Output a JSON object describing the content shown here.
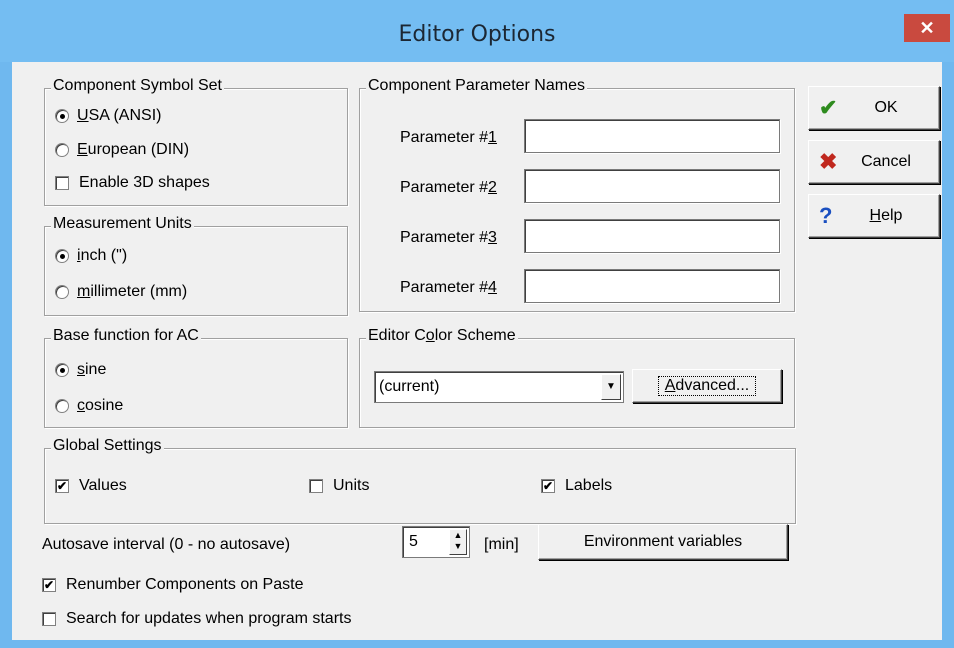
{
  "window": {
    "title": "Editor Options",
    "close_glyph": "✕"
  },
  "symbol_set": {
    "title": "Component Symbol Set",
    "options": [
      {
        "accel": "U",
        "rest": "SA (ANSI)",
        "selected": true
      },
      {
        "accel": "E",
        "rest": "uropean (DIN)",
        "selected": false
      }
    ],
    "enable_3d": {
      "label": "Enable 3D shapes",
      "checked": false
    }
  },
  "param_names": {
    "title": "Component Parameter Names",
    "params": [
      {
        "prefix": "Parameter #",
        "accel": "1",
        "value": ""
      },
      {
        "prefix": "Parameter #",
        "accel": "2",
        "value": ""
      },
      {
        "prefix": "Parameter #",
        "accel": "3",
        "value": ""
      },
      {
        "prefix": "Parameter #",
        "accel": "4",
        "value": ""
      }
    ]
  },
  "units": {
    "title": "Measurement Units",
    "options": [
      {
        "accel": "i",
        "rest": "nch (\")",
        "selected": true
      },
      {
        "accel": "m",
        "rest": "illimeter (mm)",
        "selected": false
      }
    ]
  },
  "ac_function": {
    "title": "Base function for AC",
    "options": [
      {
        "accel": "s",
        "rest": "ine",
        "selected": true
      },
      {
        "accel": "c",
        "rest": "osine",
        "selected": false
      }
    ]
  },
  "color_scheme": {
    "title_pre": "Editor C",
    "title_accel": "o",
    "title_post": "lor Scheme",
    "selected": "(current)",
    "advanced_accel": "A",
    "advanced_rest": "dvanced..."
  },
  "global": {
    "title": "Global Settings",
    "values": {
      "label": "Values",
      "checked": true
    },
    "units": {
      "label": "Units",
      "checked": false
    },
    "labels": {
      "label": "Labels",
      "checked": true
    }
  },
  "autosave": {
    "label": "Autosave interval (0 - no autosave)",
    "value": "5",
    "unit": "[min]",
    "env_button": "Environment variables"
  },
  "renumber": {
    "label": "Renumber Components on Paste",
    "checked": true
  },
  "updates": {
    "label": "Search for updates when program starts",
    "checked": false
  },
  "buttons": {
    "ok": {
      "label": "OK",
      "icon": "checkmark-icon",
      "icon_color": "#2e8b1e"
    },
    "cancel": {
      "label": "Cancel",
      "icon": "x-icon",
      "icon_color": "#c0281e"
    },
    "help": {
      "accel": "H",
      "rest": "elp",
      "icon": "question-icon",
      "icon_color": "#1a4fc0"
    }
  }
}
